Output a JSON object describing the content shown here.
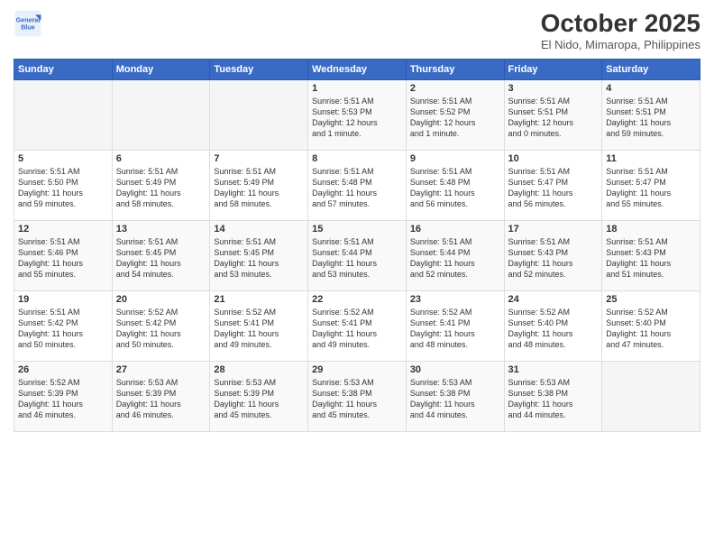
{
  "header": {
    "logo_line1": "General",
    "logo_line2": "Blue",
    "month": "October 2025",
    "location": "El Nido, Mimaropa, Philippines"
  },
  "weekdays": [
    "Sunday",
    "Monday",
    "Tuesday",
    "Wednesday",
    "Thursday",
    "Friday",
    "Saturday"
  ],
  "weeks": [
    [
      {
        "day": "",
        "info": ""
      },
      {
        "day": "",
        "info": ""
      },
      {
        "day": "",
        "info": ""
      },
      {
        "day": "1",
        "info": "Sunrise: 5:51 AM\nSunset: 5:53 PM\nDaylight: 12 hours\nand 1 minute."
      },
      {
        "day": "2",
        "info": "Sunrise: 5:51 AM\nSunset: 5:52 PM\nDaylight: 12 hours\nand 1 minute."
      },
      {
        "day": "3",
        "info": "Sunrise: 5:51 AM\nSunset: 5:51 PM\nDaylight: 12 hours\nand 0 minutes."
      },
      {
        "day": "4",
        "info": "Sunrise: 5:51 AM\nSunset: 5:51 PM\nDaylight: 11 hours\nand 59 minutes."
      }
    ],
    [
      {
        "day": "5",
        "info": "Sunrise: 5:51 AM\nSunset: 5:50 PM\nDaylight: 11 hours\nand 59 minutes."
      },
      {
        "day": "6",
        "info": "Sunrise: 5:51 AM\nSunset: 5:49 PM\nDaylight: 11 hours\nand 58 minutes."
      },
      {
        "day": "7",
        "info": "Sunrise: 5:51 AM\nSunset: 5:49 PM\nDaylight: 11 hours\nand 58 minutes."
      },
      {
        "day": "8",
        "info": "Sunrise: 5:51 AM\nSunset: 5:48 PM\nDaylight: 11 hours\nand 57 minutes."
      },
      {
        "day": "9",
        "info": "Sunrise: 5:51 AM\nSunset: 5:48 PM\nDaylight: 11 hours\nand 56 minutes."
      },
      {
        "day": "10",
        "info": "Sunrise: 5:51 AM\nSunset: 5:47 PM\nDaylight: 11 hours\nand 56 minutes."
      },
      {
        "day": "11",
        "info": "Sunrise: 5:51 AM\nSunset: 5:47 PM\nDaylight: 11 hours\nand 55 minutes."
      }
    ],
    [
      {
        "day": "12",
        "info": "Sunrise: 5:51 AM\nSunset: 5:46 PM\nDaylight: 11 hours\nand 55 minutes."
      },
      {
        "day": "13",
        "info": "Sunrise: 5:51 AM\nSunset: 5:45 PM\nDaylight: 11 hours\nand 54 minutes."
      },
      {
        "day": "14",
        "info": "Sunrise: 5:51 AM\nSunset: 5:45 PM\nDaylight: 11 hours\nand 53 minutes."
      },
      {
        "day": "15",
        "info": "Sunrise: 5:51 AM\nSunset: 5:44 PM\nDaylight: 11 hours\nand 53 minutes."
      },
      {
        "day": "16",
        "info": "Sunrise: 5:51 AM\nSunset: 5:44 PM\nDaylight: 11 hours\nand 52 minutes."
      },
      {
        "day": "17",
        "info": "Sunrise: 5:51 AM\nSunset: 5:43 PM\nDaylight: 11 hours\nand 52 minutes."
      },
      {
        "day": "18",
        "info": "Sunrise: 5:51 AM\nSunset: 5:43 PM\nDaylight: 11 hours\nand 51 minutes."
      }
    ],
    [
      {
        "day": "19",
        "info": "Sunrise: 5:51 AM\nSunset: 5:42 PM\nDaylight: 11 hours\nand 50 minutes."
      },
      {
        "day": "20",
        "info": "Sunrise: 5:52 AM\nSunset: 5:42 PM\nDaylight: 11 hours\nand 50 minutes."
      },
      {
        "day": "21",
        "info": "Sunrise: 5:52 AM\nSunset: 5:41 PM\nDaylight: 11 hours\nand 49 minutes."
      },
      {
        "day": "22",
        "info": "Sunrise: 5:52 AM\nSunset: 5:41 PM\nDaylight: 11 hours\nand 49 minutes."
      },
      {
        "day": "23",
        "info": "Sunrise: 5:52 AM\nSunset: 5:41 PM\nDaylight: 11 hours\nand 48 minutes."
      },
      {
        "day": "24",
        "info": "Sunrise: 5:52 AM\nSunset: 5:40 PM\nDaylight: 11 hours\nand 48 minutes."
      },
      {
        "day": "25",
        "info": "Sunrise: 5:52 AM\nSunset: 5:40 PM\nDaylight: 11 hours\nand 47 minutes."
      }
    ],
    [
      {
        "day": "26",
        "info": "Sunrise: 5:52 AM\nSunset: 5:39 PM\nDaylight: 11 hours\nand 46 minutes."
      },
      {
        "day": "27",
        "info": "Sunrise: 5:53 AM\nSunset: 5:39 PM\nDaylight: 11 hours\nand 46 minutes."
      },
      {
        "day": "28",
        "info": "Sunrise: 5:53 AM\nSunset: 5:39 PM\nDaylight: 11 hours\nand 45 minutes."
      },
      {
        "day": "29",
        "info": "Sunrise: 5:53 AM\nSunset: 5:38 PM\nDaylight: 11 hours\nand 45 minutes."
      },
      {
        "day": "30",
        "info": "Sunrise: 5:53 AM\nSunset: 5:38 PM\nDaylight: 11 hours\nand 44 minutes."
      },
      {
        "day": "31",
        "info": "Sunrise: 5:53 AM\nSunset: 5:38 PM\nDaylight: 11 hours\nand 44 minutes."
      },
      {
        "day": "",
        "info": ""
      }
    ]
  ]
}
